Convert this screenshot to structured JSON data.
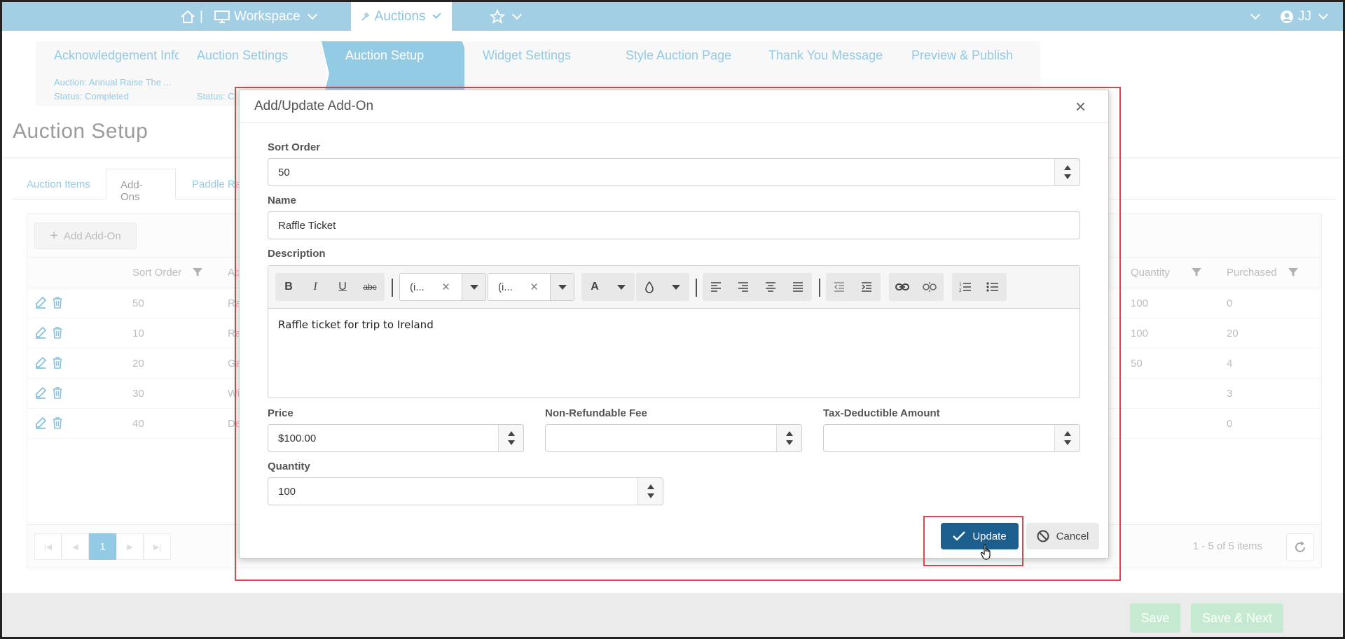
{
  "topbar": {
    "home_sep": "|",
    "workspace": "Workspace",
    "auctions": "Auctions",
    "user": "JJ",
    "color": "#72b6d6"
  },
  "steps": [
    {
      "label": "Acknowledgement Info",
      "meta1": "Auction: Annual Raise The ...",
      "meta2": "Status: Completed"
    },
    {
      "label": "Auction Settings",
      "meta1": "",
      "meta2": "Status: C"
    },
    {
      "label": "Auction Setup",
      "meta1": "",
      "meta2": ""
    },
    {
      "label": "Widget Settings",
      "meta1": "",
      "meta2": ""
    },
    {
      "label": "Style Auction Page",
      "meta1": "",
      "meta2": ""
    },
    {
      "label": "Thank You Message",
      "meta1": "",
      "meta2": ""
    },
    {
      "label": "Preview & Publish",
      "meta1": "",
      "meta2": ""
    }
  ],
  "page_title": "Auction Setup",
  "tabs": [
    "Auction Items",
    "Add-Ons",
    "Paddle Rai"
  ],
  "grid": {
    "add_button": "Add Add-On",
    "headers": {
      "sort_order": "Sort Order",
      "name": "Ad",
      "quantity": "Quantity",
      "purchased": "Purchased"
    },
    "rows": [
      {
        "sort": "50",
        "name": "Ra",
        "qty": "100",
        "purchased": "0"
      },
      {
        "sort": "10",
        "name": "Ra",
        "qty": "100",
        "purchased": "20"
      },
      {
        "sort": "20",
        "name": "Ga",
        "qty": "50",
        "purchased": "4"
      },
      {
        "sort": "30",
        "name": "Wi",
        "qty": "",
        "purchased": "3"
      },
      {
        "sort": "40",
        "name": "De",
        "qty": "",
        "purchased": "0"
      }
    ],
    "pager": {
      "current": "1",
      "info": "1 - 5 of 5 items"
    }
  },
  "footer": {
    "save": "Save",
    "save_next": "Save & Next"
  },
  "modal": {
    "title": "Add/Update Add-On",
    "close": "×",
    "sort_order": {
      "label": "Sort Order",
      "value": "50"
    },
    "name": {
      "label": "Name",
      "value": "Raffle Ticket"
    },
    "description": {
      "label": "Description",
      "font_family": "(i...",
      "font_size": "(i...",
      "content": "Raffle ticket for trip to Ireland"
    },
    "price": {
      "label": "Price",
      "value": "$100.00"
    },
    "fee": {
      "label": "Non-Refundable Fee",
      "value": ""
    },
    "tax": {
      "label": "Tax-Deductible Amount",
      "value": ""
    },
    "quantity": {
      "label": "Quantity",
      "value": "100"
    },
    "update": "Update",
    "cancel": "Cancel"
  },
  "colors": {
    "accent": "#5aaed6",
    "primary_button": "#1c5e8e",
    "highlight": "#e0434f",
    "footer_button": "#a8dfb8"
  }
}
